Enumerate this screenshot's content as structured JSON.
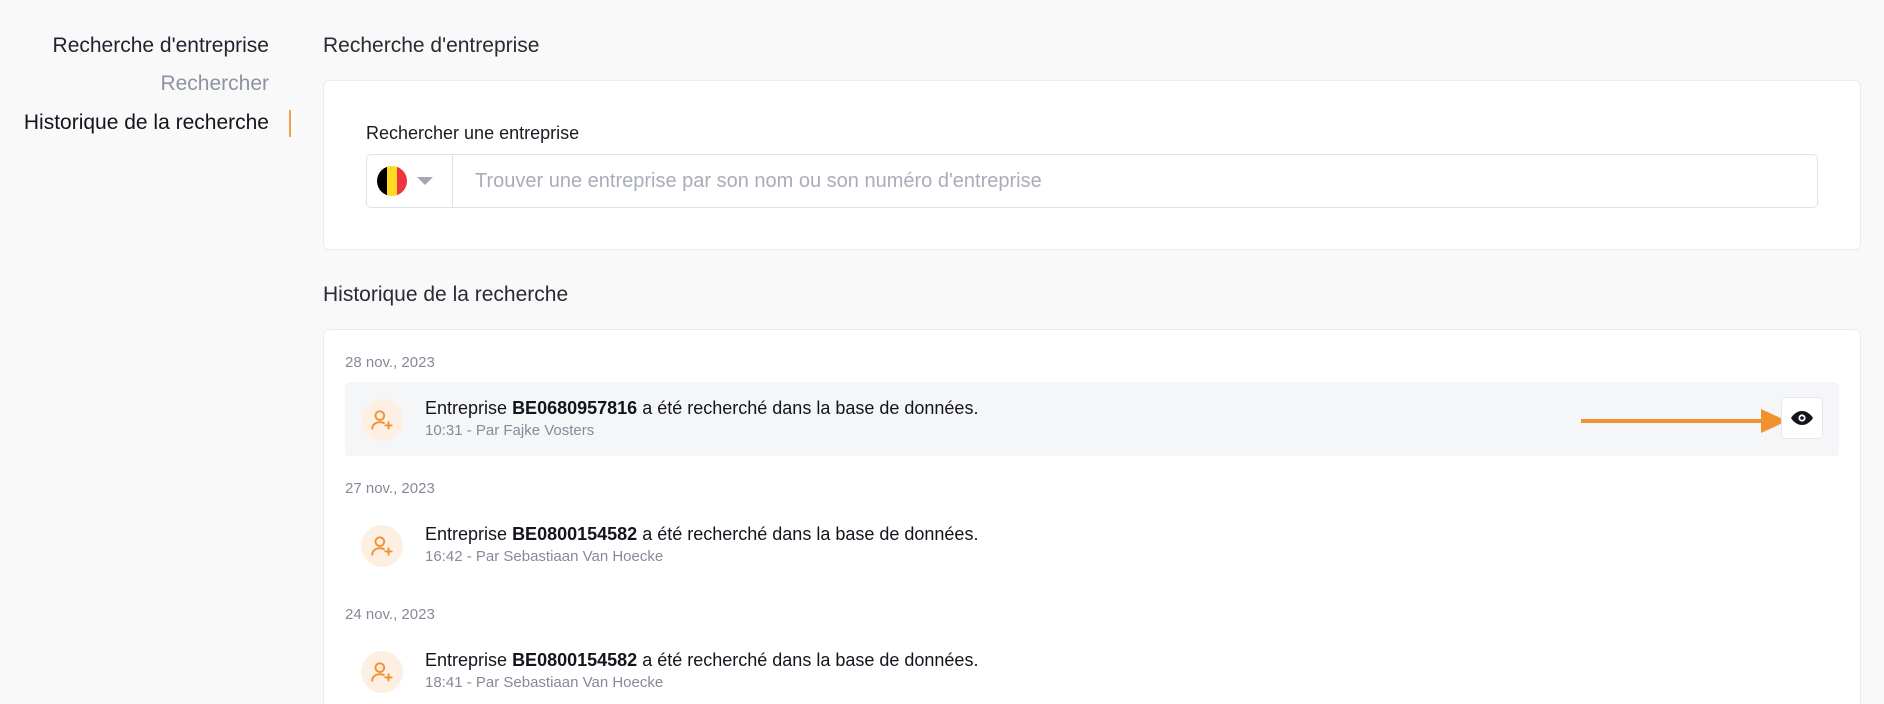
{
  "sidebar": {
    "title": "Recherche d'entreprise",
    "items": [
      {
        "label": "Rechercher",
        "active": false
      },
      {
        "label": "Historique de la recherche",
        "active": true
      }
    ]
  },
  "search_section": {
    "title": "Recherche d'entreprise",
    "label": "Rechercher une entreprise",
    "country": "BE",
    "flag_colors": [
      "#000000",
      "#FDDA24",
      "#EF3340"
    ],
    "placeholder": "Trouver une entreprise par son nom ou son numéro d'entreprise"
  },
  "history_section": {
    "title": "Historique de la recherche",
    "groups": [
      {
        "date": "28 nov., 2023",
        "entry": {
          "prefix": "Entreprise",
          "number": "BE0680957816",
          "suffix": "a été recherché dans la base de données.",
          "meta": "10:31 - Par Fajke Vosters",
          "highlighted": true,
          "action_icon": "eye-icon"
        }
      },
      {
        "date": "27 nov., 2023",
        "entry": {
          "prefix": "Entreprise",
          "number": "BE0800154582",
          "suffix": "a été recherché dans la base de données.",
          "meta": "16:42 - Par Sebastiaan Van Hoecke",
          "highlighted": false
        }
      },
      {
        "date": "24 nov., 2023",
        "entry": {
          "prefix": "Entreprise",
          "number": "BE0800154582",
          "suffix": "a été recherché dans la base de données.",
          "meta": "18:41 - Par Sebastiaan Van Hoecke",
          "highlighted": false
        }
      }
    ]
  },
  "colors": {
    "accent": "#F0A04B",
    "arrow": "#F0932E",
    "avatar_bg": "#FDF0E2",
    "avatar_icon": "#F0932E"
  }
}
